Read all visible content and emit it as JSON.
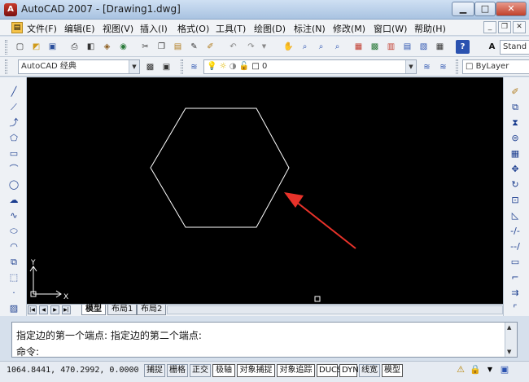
{
  "window": {
    "title": "AutoCAD 2007 - [Drawing1.dwg]",
    "app_icon": "A",
    "controls": {
      "minimize": "▁",
      "maximize": "□",
      "close": "✕"
    }
  },
  "menu": {
    "items": [
      "文件(F)",
      "编辑(E)",
      "视图(V)",
      "插入(I)",
      "格式(O)",
      "工具(T)",
      "绘图(D)",
      "标注(N)",
      "修改(M)",
      "窗口(W)",
      "帮助(H)"
    ],
    "mdi": {
      "minimize": "_",
      "restore": "❐",
      "close": "✕"
    }
  },
  "toolbar": {
    "workspace": "AutoCAD 经典",
    "layer": "0",
    "style_combo": "Stand",
    "linetype": "ByLayer"
  },
  "canvas": {
    "background": "#000000",
    "hexagon_color": "#ffffff",
    "arrow_color": "#e8322a",
    "ucs": {
      "x_label": "X",
      "y_label": "Y"
    }
  },
  "tabs": [
    "模型",
    "布局1",
    "布局2"
  ],
  "command": {
    "history": "指定边的第一个端点: 指定边的第二个端点:",
    "prompt": "命令:"
  },
  "status": {
    "coords": "1064.8441, 470.2992, 0.0000",
    "buttons": [
      {
        "label": "捕捉",
        "on": false
      },
      {
        "label": "栅格",
        "on": false
      },
      {
        "label": "正交",
        "on": false
      },
      {
        "label": "极轴",
        "on": true
      },
      {
        "label": "对象捕捉",
        "on": true
      },
      {
        "label": "对象追踪",
        "on": true
      },
      {
        "label": "DUCS",
        "on": true
      },
      {
        "label": "DYN",
        "on": true
      },
      {
        "label": "线宽",
        "on": false
      },
      {
        "label": "模型",
        "on": true
      }
    ]
  }
}
